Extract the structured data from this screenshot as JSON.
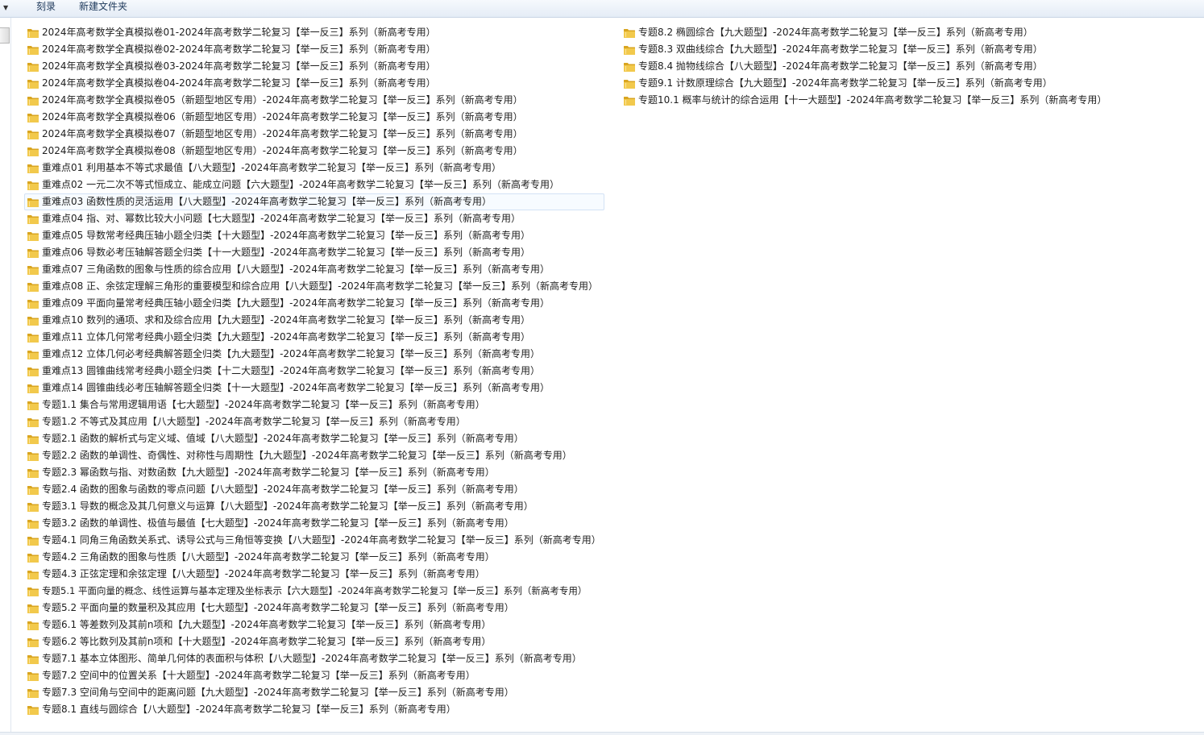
{
  "toolbar": {
    "dropdown_icon": "chevron-down-icon",
    "burn_label": "刻录",
    "new_folder_label": "新建文件夹"
  },
  "colors": {
    "folder_fill": "#f2c94c",
    "folder_dark": "#d9a520",
    "selection_border": "#d3e2f5",
    "toolbar_text": "#1e395b"
  },
  "selected_index": 10,
  "folders": [
    "2024年高考数学全真模拟卷01-2024年高考数学二轮复习【举一反三】系列（新高考专用）",
    "2024年高考数学全真模拟卷02-2024年高考数学二轮复习【举一反三】系列（新高考专用）",
    "2024年高考数学全真模拟卷03-2024年高考数学二轮复习【举一反三】系列（新高考专用）",
    "2024年高考数学全真模拟卷04-2024年高考数学二轮复习【举一反三】系列（新高考专用）",
    "2024年高考数学全真模拟卷05（新题型地区专用）-2024年高考数学二轮复习【举一反三】系列（新高考专用）",
    "2024年高考数学全真模拟卷06（新题型地区专用）-2024年高考数学二轮复习【举一反三】系列（新高考专用）",
    "2024年高考数学全真模拟卷07（新题型地区专用）-2024年高考数学二轮复习【举一反三】系列（新高考专用）",
    "2024年高考数学全真模拟卷08（新题型地区专用）-2024年高考数学二轮复习【举一反三】系列（新高考专用）",
    "重难点01 利用基本不等式求最值【八大题型】-2024年高考数学二轮复习【举一反三】系列（新高考专用）",
    "重难点02 一元二次不等式恒成立、能成立问题【六大题型】-2024年高考数学二轮复习【举一反三】系列（新高考专用）",
    "重难点03 函数性质的灵活运用【八大题型】-2024年高考数学二轮复习【举一反三】系列（新高考专用）",
    "重难点04 指、对、幂数比较大小问题【七大题型】-2024年高考数学二轮复习【举一反三】系列（新高考专用）",
    "重难点05 导数常考经典压轴小题全归类【十大题型】-2024年高考数学二轮复习【举一反三】系列（新高考专用）",
    "重难点06 导数必考压轴解答题全归类【十一大题型】-2024年高考数学二轮复习【举一反三】系列（新高考专用）",
    "重难点07 三角函数的图象与性质的综合应用【八大题型】-2024年高考数学二轮复习【举一反三】系列（新高考专用）",
    "重难点08 正、余弦定理解三角形的重要模型和综合应用【八大题型】-2024年高考数学二轮复习【举一反三】系列（新高考专用）",
    "重难点09 平面向量常考经典压轴小题全归类【九大题型】-2024年高考数学二轮复习【举一反三】系列（新高考专用）",
    "重难点10 数列的通项、求和及综合应用【九大题型】-2024年高考数学二轮复习【举一反三】系列（新高考专用）",
    "重难点11 立体几何常考经典小题全归类【九大题型】-2024年高考数学二轮复习【举一反三】系列（新高考专用）",
    "重难点12 立体几何必考经典解答题全归类【九大题型】-2024年高考数学二轮复习【举一反三】系列（新高考专用）",
    "重难点13 圆锥曲线常考经典小题全归类【十二大题型】-2024年高考数学二轮复习【举一反三】系列（新高考专用）",
    "重难点14 圆锥曲线必考压轴解答题全归类【十一大题型】-2024年高考数学二轮复习【举一反三】系列（新高考专用）",
    "专题1.1 集合与常用逻辑用语【七大题型】-2024年高考数学二轮复习【举一反三】系列（新高考专用）",
    "专题1.2 不等式及其应用【八大题型】-2024年高考数学二轮复习【举一反三】系列（新高考专用）",
    "专题2.1 函数的解析式与定义域、值域【八大题型】-2024年高考数学二轮复习【举一反三】系列（新高考专用）",
    "专题2.2 函数的单调性、奇偶性、对称性与周期性【九大题型】-2024年高考数学二轮复习【举一反三】系列（新高考专用）",
    "专题2.3 幂函数与指、对数函数【九大题型】-2024年高考数学二轮复习【举一反三】系列（新高考专用）",
    "专题2.4 函数的图象与函数的零点问题【八大题型】-2024年高考数学二轮复习【举一反三】系列（新高考专用）",
    "专题3.1 导数的概念及其几何意义与运算【八大题型】-2024年高考数学二轮复习【举一反三】系列（新高考专用）",
    "专题3.2 函数的单调性、极值与最值【七大题型】-2024年高考数学二轮复习【举一反三】系列（新高考专用）",
    "专题4.1 同角三角函数关系式、诱导公式与三角恒等变换【八大题型】-2024年高考数学二轮复习【举一反三】系列（新高考专用）",
    "专题4.2 三角函数的图象与性质【八大题型】-2024年高考数学二轮复习【举一反三】系列（新高考专用）",
    "专题4.3 正弦定理和余弦定理【八大题型】-2024年高考数学二轮复习【举一反三】系列（新高考专用）",
    "专题5.1 平面向量的概念、线性运算与基本定理及坐标表示【六大题型】-2024年高考数学二轮复习【举一反三】系列（新高考专用）",
    "专题5.2 平面向量的数量积及其应用【七大题型】-2024年高考数学二轮复习【举一反三】系列（新高考专用）",
    "专题6.1 等差数列及其前n项和【九大题型】-2024年高考数学二轮复习【举一反三】系列（新高考专用）",
    "专题6.2 等比数列及其前n项和【十大题型】-2024年高考数学二轮复习【举一反三】系列（新高考专用）",
    "专题7.1 基本立体图形、简单几何体的表面积与体积【八大题型】-2024年高考数学二轮复习【举一反三】系列（新高考专用）",
    "专题7.2 空间中的位置关系【十大题型】-2024年高考数学二轮复习【举一反三】系列（新高考专用）",
    "专题7.3 空间角与空间中的距离问题【九大题型】-2024年高考数学二轮复习【举一反三】系列（新高考专用）",
    "专题8.1 直线与圆综合【八大题型】-2024年高考数学二轮复习【举一反三】系列（新高考专用）",
    "专题8.2 椭圆综合【九大题型】-2024年高考数学二轮复习【举一反三】系列（新高考专用）",
    "专题8.3 双曲线综合【九大题型】-2024年高考数学二轮复习【举一反三】系列（新高考专用）",
    "专题8.4 抛物线综合【八大题型】-2024年高考数学二轮复习【举一反三】系列（新高考专用）",
    "专题9.1 计数原理综合【九大题型】-2024年高考数学二轮复习【举一反三】系列（新高考专用）",
    "专题10.1 概率与统计的综合运用【十一大题型】-2024年高考数学二轮复习【举一反三】系列（新高考专用）"
  ]
}
